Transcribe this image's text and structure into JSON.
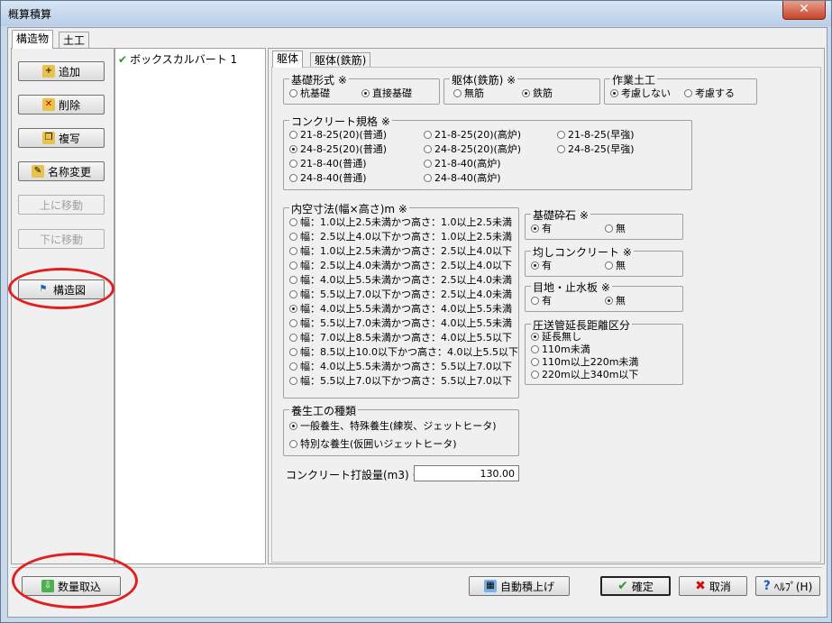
{
  "window": {
    "title": "概算積算",
    "close": "✕"
  },
  "main_tabs": [
    "構造物",
    "土工"
  ],
  "left_buttons": {
    "add": "追加",
    "delete": "削除",
    "copy": "複写",
    "rename": "名称変更",
    "move_up": "上に移動",
    "move_down": "下に移動",
    "structure_diagram": "構造図"
  },
  "tree": {
    "items": [
      "ボックスカルバート 1"
    ]
  },
  "sub_tabs": [
    "躯体",
    "躯体(鉄筋)"
  ],
  "foundation_type": {
    "label": "基礎形式 ※",
    "options": [
      "杭基礎",
      "直接基礎"
    ],
    "selected": 1
  },
  "body_rebar": {
    "label": "躯体(鉄筋) ※",
    "options": [
      "無筋",
      "鉄筋"
    ],
    "selected": 1
  },
  "earthwork": {
    "label": "作業土工",
    "options": [
      "考慮しない",
      "考慮する"
    ],
    "selected": 0
  },
  "concrete_spec": {
    "label": "コンクリート規格 ※",
    "options": [
      "21-8-25(20)(普通)",
      "21-8-25(20)(高炉)",
      "21-8-25(早強)",
      "24-8-25(20)(普通)",
      "24-8-25(20)(高炉)",
      "24-8-25(早強)",
      "21-8-40(普通)",
      "21-8-40(高炉)",
      "24-8-40(普通)",
      "24-8-40(高炉)"
    ],
    "selected": 3
  },
  "inner_dims": {
    "label": "内空寸法(幅×高さ)m ※",
    "options": [
      "幅：1.0以上2.5未満かつ高さ：1.0以上2.5未満",
      "幅：2.5以上4.0以下かつ高さ：1.0以上2.5未満",
      "幅：1.0以上2.5未満かつ高さ：2.5以上4.0以下",
      "幅：2.5以上4.0未満かつ高さ：2.5以上4.0以下",
      "幅：4.0以上5.5未満かつ高さ：2.5以上4.0未満",
      "幅：5.5以上7.0以下かつ高さ：2.5以上4.0未満",
      "幅：4.0以上5.5未満かつ高さ：4.0以上5.5未満",
      "幅：5.5以上7.0未満かつ高さ：4.0以上5.5未満",
      "幅：7.0以上8.5未満かつ高さ：4.0以上5.5以下",
      "幅：8.5以上10.0以下かつ高さ：4.0以上5.5以下",
      "幅：4.0以上5.5未満かつ高さ：5.5以上7.0以下",
      "幅：5.5以上7.0以下かつ高さ：5.5以上7.0以下"
    ],
    "selected": 6
  },
  "base_gravel": {
    "label": "基礎砕石 ※",
    "options": [
      "有",
      "無"
    ],
    "selected": 0
  },
  "leveling_concrete": {
    "label": "均しコンクリート ※",
    "options": [
      "有",
      "無"
    ],
    "selected": 0
  },
  "joint_waterstop": {
    "label": "目地・止水板 ※",
    "options": [
      "有",
      "無"
    ],
    "selected": 1
  },
  "pump_distance": {
    "label": "圧送管延長距離区分",
    "options": [
      "延長無し",
      "110m未満",
      "110m以上220m未満",
      "220m以上340m以下"
    ],
    "selected": 0
  },
  "curing": {
    "label": "養生工の種類",
    "options": [
      "一般養生、特殊養生(練炭、ジェットヒータ)",
      "特別な養生(仮囲いジェットヒータ)"
    ],
    "selected": 0
  },
  "concrete_volume": {
    "label": "コンクリート打設量(m3) ※",
    "value": "130.00"
  },
  "bottom_buttons": {
    "import_quantity": "数量取込",
    "auto_calc": "自動積上げ",
    "confirm": "確定",
    "cancel": "取消",
    "help": "ﾍﾙﾌﾟ(H)"
  },
  "colors": {
    "annotation": "#e02020",
    "confirm_check": "#2a9a2a",
    "cancel_x": "#cc1111",
    "help_q": "#1a5fbf"
  }
}
